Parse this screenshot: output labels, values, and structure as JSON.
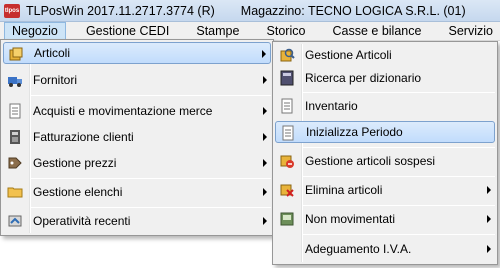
{
  "window": {
    "title": "TLPosWin 2017.11.2717.3774 (R)",
    "warehouse": "Magazzino: TECNO LOGICA S.R.L. (01)",
    "app_icon_text": "tlpos"
  },
  "menubar": [
    {
      "label": "Negozio",
      "active": true
    },
    {
      "label": "Gestione CEDI"
    },
    {
      "label": "Stampe"
    },
    {
      "label": "Storico"
    },
    {
      "label": "Casse e bilance"
    },
    {
      "label": "Servizio"
    }
  ],
  "main_menu": [
    {
      "label": "Articoli",
      "icon": "articles-icon",
      "submenu": true,
      "highlight": true
    },
    {
      "label": "Fornitori",
      "icon": "suppliers-icon",
      "submenu": true
    },
    {
      "label": "Acquisti e movimentazione merce",
      "icon": "purchases-icon",
      "submenu": true
    },
    {
      "label": "Fatturazione clienti",
      "icon": "invoice-icon",
      "submenu": true
    },
    {
      "label": "Gestione prezzi",
      "icon": "prices-icon",
      "submenu": true
    },
    {
      "label": "Gestione elenchi",
      "icon": "folder-icon",
      "submenu": true
    },
    {
      "label": "Operatività recenti",
      "icon": "recent-icon",
      "submenu": true
    }
  ],
  "sub_menu": [
    {
      "label": "Gestione Articoli",
      "icon": "manage-articles-icon"
    },
    {
      "label": "Ricerca per dizionario",
      "icon": "dictionary-search-icon"
    },
    {
      "label": "Inventario",
      "icon": "inventory-icon"
    },
    {
      "label": "Inizializza Periodo",
      "icon": "init-period-icon",
      "highlight": true
    },
    {
      "label": "Gestione articoli sospesi",
      "icon": "suspended-articles-icon"
    },
    {
      "label": "Elimina articoli",
      "icon": "delete-articles-icon",
      "submenu": true
    },
    {
      "label": "Non movimentati",
      "icon": "not-moved-icon",
      "submenu": true
    },
    {
      "label": "Adeguamento I.V.A.",
      "icon": "vat-icon",
      "submenu": true
    }
  ]
}
